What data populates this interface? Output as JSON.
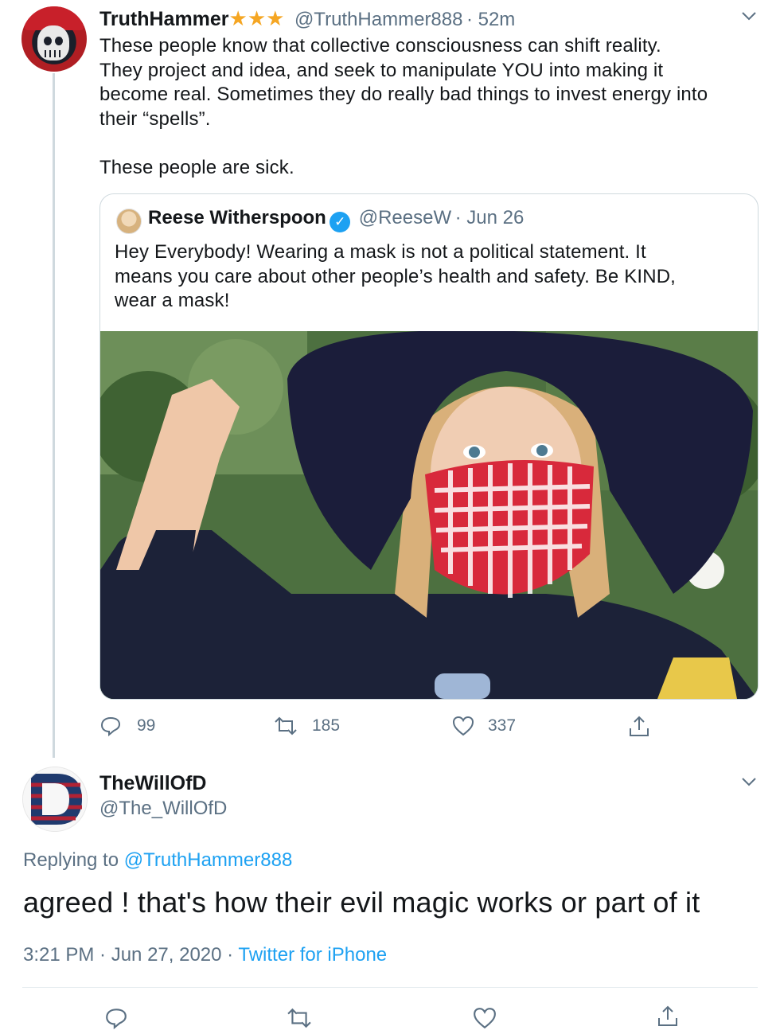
{
  "tweet1": {
    "name": "TruthHammer",
    "stars": "★★★",
    "handle": "@TruthHammer888",
    "time": "· 52m",
    "text": "These people know that collective consciousness can shift reality.\nThey project and idea, and seek to manipulate YOU into making it\nbecome real. Sometimes they do really bad things to invest energy into\ntheir “spells”.\n\nThese people are sick.",
    "quote": {
      "name": "Reese Witherspoon",
      "verified_glyph": "✓",
      "handle": "@ReeseW",
      "date": "· Jun 26",
      "text": "Hey Everybody! Wearing a mask is not a political statement. It\nmeans you care about other people’s health and safety. Be KIND,\nwear a mask!"
    },
    "actions": {
      "replies": "99",
      "retweets": "185",
      "likes": "337"
    }
  },
  "tweet2": {
    "avatar_letter": "D",
    "name": "TheWillOfD",
    "handle": "@The_WillOfD",
    "replying_prefix": "Replying to",
    "replying_handle": "@TruthHammer888",
    "text": "agreed ! that's how their evil magic works or part of it",
    "timestamp": "3:21 PM · Jun 27, 2020 ·",
    "source": "Twitter for iPhone"
  },
  "colors": {
    "accent": "#1da1f2",
    "muted": "#5b7083",
    "star": "#f5a623"
  },
  "icons": [
    "chevron-down-icon",
    "verified-icon",
    "reply-icon",
    "retweet-icon",
    "like-icon",
    "share-icon"
  ]
}
